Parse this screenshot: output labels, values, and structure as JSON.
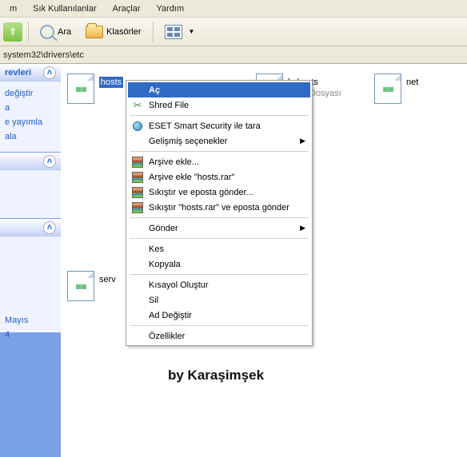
{
  "menubar": {
    "items": [
      "m",
      "Sık Kullanılanlar",
      "Araçlar",
      "Yardım"
    ]
  },
  "toolbar": {
    "search": "Ara",
    "folders": "Klasörler"
  },
  "addrbar": {
    "path": "system32\\drivers\\etc"
  },
  "sidebar": {
    "panel1": {
      "title": "revleri",
      "links": [
        "değiştir",
        "a",
        "e yayımla",
        "ala"
      ]
    },
    "panel2": {
      "title": ""
    },
    "panel3": {
      "date_line": "Mayıs",
      "line2": "4"
    }
  },
  "files": [
    {
      "name": "hosts",
      "sub": "",
      "selected": true,
      "row": 0,
      "col": 0
    },
    {
      "name": "lmhosts",
      "sub": "SAM Dosyası",
      "selected": false,
      "row": 0,
      "col": 1
    },
    {
      "name": "net",
      "sub": "",
      "selected": false,
      "row": 0,
      "col": 2
    },
    {
      "name": "serv",
      "sub": "",
      "selected": false,
      "row": 1,
      "col": 0
    }
  ],
  "context": {
    "open": "Aç",
    "shred": "Shred File",
    "eset": "ESET Smart Security ile tara",
    "advanced": "Gelişmiş seçenekler",
    "arc1": "Arşive ekle...",
    "arc2": "Arşive ekle \"hosts.rar\"",
    "arc3": "Sıkıştır ve eposta gönder...",
    "arc4": "Sıkıştır \"hosts.rar\" ve eposta gönder",
    "sendto": "Gönder",
    "cut": "Kes",
    "copy": "Kopyala",
    "shortcut": "Kısayol Oluştur",
    "delete": "Sil",
    "rename": "Ad Değiştir",
    "props": "Özellikler"
  },
  "watermark": "by Karaşimşek"
}
